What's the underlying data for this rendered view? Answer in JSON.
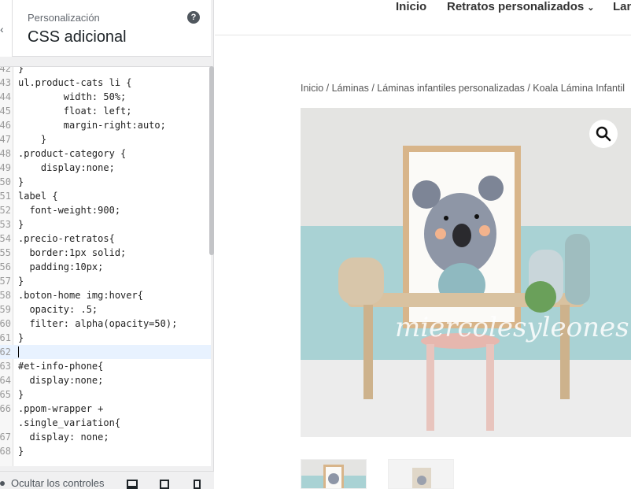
{
  "panel": {
    "crumb": "Personalización",
    "title": "CSS adicional",
    "help": "?"
  },
  "editor": {
    "lines": [
      {
        "n": "42",
        "code": "}"
      },
      {
        "n": "43",
        "code": "ul.product-cats li {"
      },
      {
        "n": "44",
        "code": "        width: 50%;"
      },
      {
        "n": "45",
        "code": "        float: left;"
      },
      {
        "n": "46",
        "code": "        margin-right:auto;"
      },
      {
        "n": "47",
        "code": "    }"
      },
      {
        "n": "48",
        "code": ".product-category {"
      },
      {
        "n": "49",
        "code": "    display:none;"
      },
      {
        "n": "50",
        "code": "}"
      },
      {
        "n": "51",
        "code": "label {"
      },
      {
        "n": "52",
        "code": "  font-weight:900;"
      },
      {
        "n": "53",
        "code": "}"
      },
      {
        "n": "54",
        "code": ".precio-retratos{"
      },
      {
        "n": "55",
        "code": "  border:1px solid;"
      },
      {
        "n": "56",
        "code": "  padding:10px;"
      },
      {
        "n": "57",
        "code": "}"
      },
      {
        "n": "58",
        "code": ".boton-home img:hover{"
      },
      {
        "n": "59",
        "code": "  opacity: .5;"
      },
      {
        "n": "60",
        "code": "  filter: alpha(opacity=50);"
      },
      {
        "n": "61",
        "code": "}"
      },
      {
        "n": "62",
        "code": ""
      },
      {
        "n": "63",
        "code": "#et-info-phone{"
      },
      {
        "n": "64",
        "code": "  display:none;"
      },
      {
        "n": "65",
        "code": "}"
      },
      {
        "n": "66",
        "code": ".ppom-wrapper +"
      },
      {
        "n": "",
        "code": ".single_variation{"
      },
      {
        "n": "67",
        "code": "  display: none;"
      },
      {
        "n": "68",
        "code": "}"
      }
    ]
  },
  "footer": {
    "hide_controls": "Ocultar los controles"
  },
  "preview": {
    "nav": {
      "inicio": "Inicio",
      "retratos": "Retratos personalizados",
      "lan": "Lan"
    },
    "breadcrumb": "Inicio / Láminas / Láminas infantiles personalizadas / Koala Lámina Infantil",
    "watermark": "miercolesyleones"
  },
  "colors": {
    "accent": "#2271b1",
    "panel_bg": "#f0f0f1",
    "wall_top": "#e3e3e2",
    "wall_bottom": "#a8d1d3"
  }
}
